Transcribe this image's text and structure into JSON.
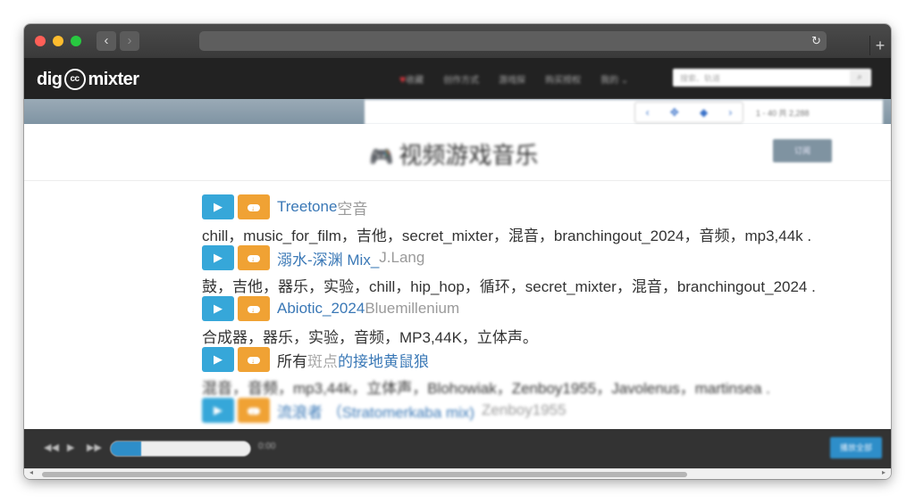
{
  "browser": {
    "back_label": "‹",
    "forward_label": "›",
    "reload_label": "↻",
    "newtab_label": "+"
  },
  "site": {
    "logo_left": "dig",
    "logo_cc": "cc",
    "logo_right": "mixter",
    "nav": [
      "收藏",
      "创作方式",
      "游戏探",
      "购买授权",
      "我的"
    ],
    "search_placeholder": "搜索、轨道"
  },
  "strip": {
    "prev": "‹",
    "tool_a": "✥",
    "tool_b": "◆",
    "next": "›",
    "page_info": "1 - 40 共 2,288"
  },
  "heading": {
    "icon": "🎮",
    "title": "视频游戏音乐",
    "subscribe": "订阅"
  },
  "uploads": [
    {
      "track": "Treetone",
      "artist": "空音",
      "tags": "chill，music_for_film，吉他，secret_mixter，混音，branchingout_2024，音频，mp3,44k ."
    },
    {
      "track": "溺水-深渊 Mix_",
      "artist": "J.Lang",
      "tags": "鼓，吉他，器乐，实验，chill，hip_hop，循环，secret_mixter，混音，branchingout_2024 ."
    },
    {
      "track": "Abiotic_2024",
      "artist": "Bluemillenium",
      "tags": "合成器，器乐，实验，音频，MP3,44K，立体声。"
    },
    {
      "prefix": "所有",
      "middle": "斑点",
      "track": "的接地黄鼠狼",
      "tags": "混音，音频，mp3,44k，立体声，Blohowiak，Zenboy1955，Javolenus，martinsea ."
    },
    {
      "track": "流浪者 （Stratomerkaba mix)",
      "artist": "Zenboy1955"
    }
  ],
  "player": {
    "prev": "◀◀",
    "play": "▶",
    "next": "▶▶",
    "progress": 0.22,
    "time": "0:00",
    "play_all": "播放全部"
  },
  "icons": {
    "play": "play-icon",
    "download": "cloud-download-icon",
    "gamepad": "gamepad-icon"
  },
  "colors": {
    "play_button": "#36a7d9",
    "download_button": "#f0a234",
    "link": "#3a78b6",
    "nav_bg": "#222222"
  }
}
